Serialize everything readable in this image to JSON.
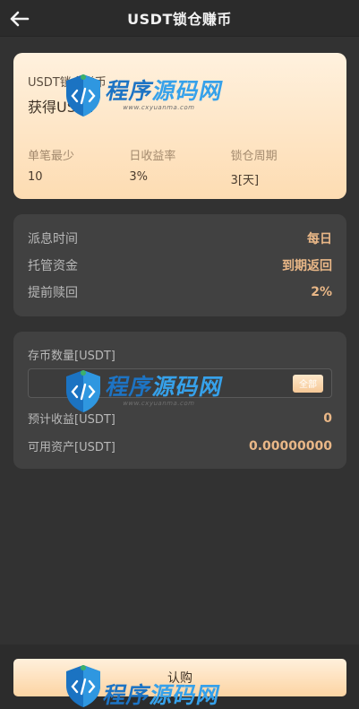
{
  "header": {
    "title": "USDT锁仓赚币"
  },
  "product": {
    "name": "USDT锁仓赚币",
    "earn": "获得USDT",
    "stats": [
      {
        "label": "单笔最少",
        "value": "10"
      },
      {
        "label": "日收益率",
        "value": "3%"
      },
      {
        "label": "锁仓周期",
        "value": "3[天]"
      }
    ]
  },
  "info": {
    "rows": [
      {
        "label": "派息时间",
        "value": "每日"
      },
      {
        "label": "托管资金",
        "value": "到期返回"
      },
      {
        "label": "提前赎回",
        "value": "2%"
      }
    ]
  },
  "deposit": {
    "label": "存币数量[USDT]",
    "input_value": "",
    "input_placeholder": "",
    "all_button": "全部",
    "rows": [
      {
        "label": "预计收益[USDT]",
        "value": "0"
      },
      {
        "label": "可用资产[USDT]",
        "value": "0.00000000"
      }
    ]
  },
  "footer": {
    "buy_button": "认购"
  },
  "watermark": {
    "text_a": "程序",
    "text_b": "源码网",
    "url": "www.cxyuanma.com"
  }
}
